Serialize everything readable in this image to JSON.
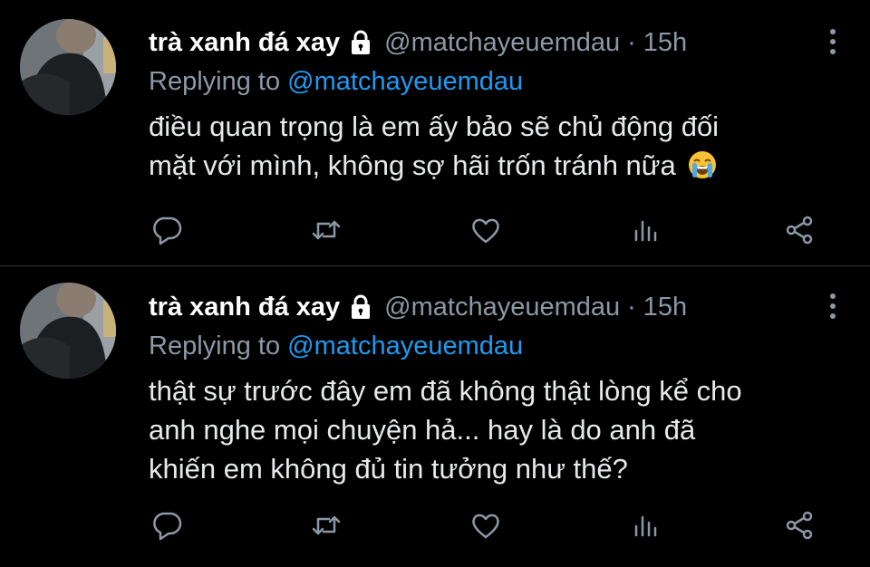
{
  "tweets": [
    {
      "name": "trà xanh đá xay",
      "handle": "@matchayeuemdau",
      "separator": "·",
      "time": "15h",
      "reply_prefix": "Replying to",
      "reply_handle": "@matchayeuemdau",
      "lines": [
        "điều quan trọng là em ấy bảo sẽ chủ động đối",
        "mặt với mình, không sợ hãi trốn tránh nữa"
      ],
      "emoji": "loudly-crying-face-icon"
    },
    {
      "name": "trà xanh đá xay",
      "handle": "@matchayeuemdau",
      "separator": "·",
      "time": "15h",
      "reply_prefix": "Replying to",
      "reply_handle": "@matchayeuemdau",
      "lines": [
        "thật sự trước đây em đã không thật lòng kể cho",
        "anh nghe mọi chuyện hả... hay là do anh đã",
        "khiến em không đủ tin tưởng như thế?"
      ]
    }
  ],
  "icons": [
    "lock-icon",
    "more-options-icon",
    "reply-icon",
    "retweet-icon",
    "like-icon",
    "analytics-icon",
    "share-icon"
  ],
  "colors": {
    "background": "#000000",
    "secondary_text": "#8b98a5",
    "link": "#1d9bf0",
    "divider": "#2f3336"
  }
}
